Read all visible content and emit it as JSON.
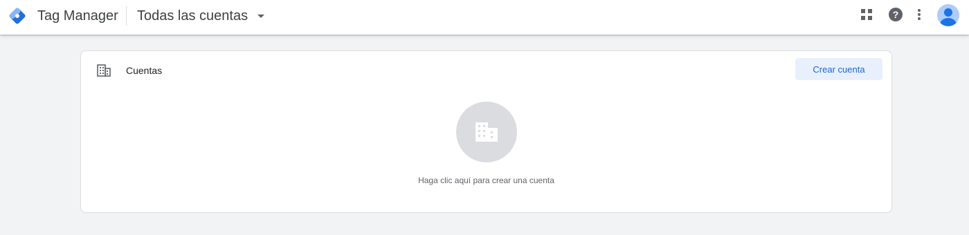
{
  "header": {
    "app_title": "Tag Manager",
    "account_selector": "Todas las cuentas",
    "icons": {
      "logo": "tag-manager-logo-icon",
      "apps": "apps-grid-icon",
      "help": "help-icon",
      "more": "more-vert-icon",
      "avatar": "account-avatar-icon"
    },
    "help_glyph": "?"
  },
  "accounts_card": {
    "title": "Cuentas",
    "create_button_label": "Crear cuenta",
    "empty_state_text": "Haga clic aquí para crear una cuenta",
    "icon": "building-icon"
  },
  "colors": {
    "brand_blue": "#246fdb",
    "brand_light_blue": "#8ab4f8",
    "button_bg": "#e8f0fe",
    "button_text": "#1967d2",
    "page_bg": "#f1f3f4"
  }
}
